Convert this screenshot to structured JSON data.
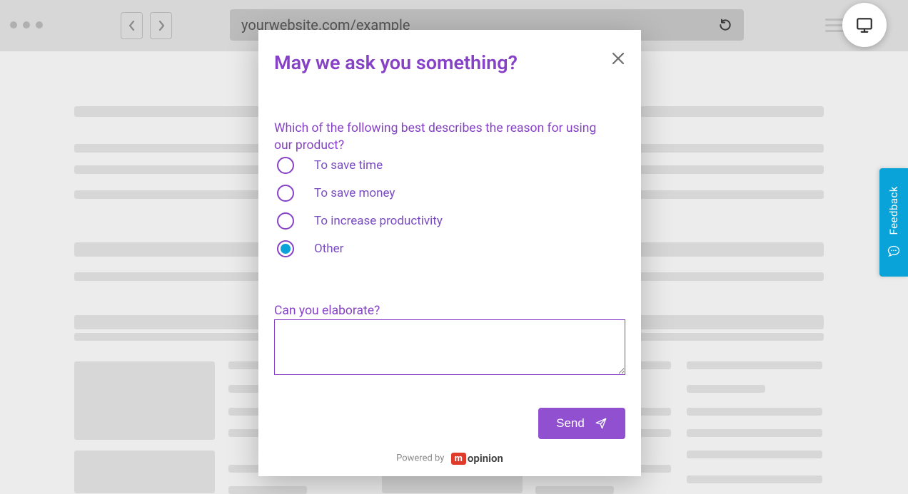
{
  "browser": {
    "url": "yourwebsite.com/example"
  },
  "feedback_tab": {
    "label": "Feedback"
  },
  "modal": {
    "title": "May we ask you something?",
    "question1": "Which of the following best describes the reason for using our product?",
    "options": [
      {
        "label": "To save time",
        "selected": false
      },
      {
        "label": "To save money",
        "selected": false
      },
      {
        "label": "To increase productivity",
        "selected": false
      },
      {
        "label": "Other",
        "selected": true
      }
    ],
    "question2": "Can you elaborate?",
    "textarea_value": "",
    "send_label": "Send",
    "powered_by_prefix": "Powered by",
    "powered_by_brand_m": "m",
    "powered_by_brand_rest": "opinion"
  }
}
